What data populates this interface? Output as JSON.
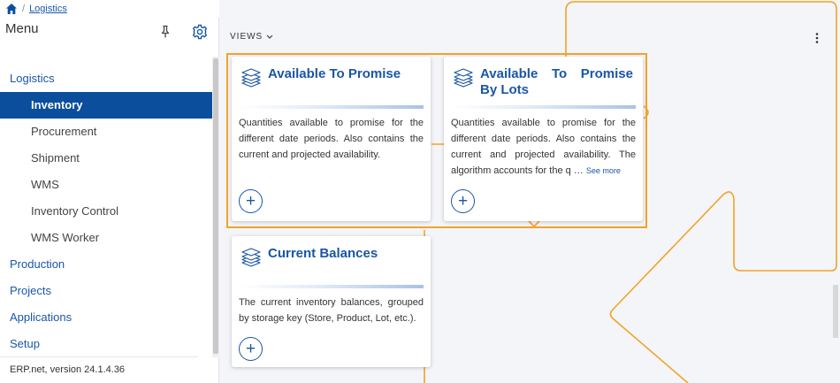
{
  "breadcrumb": {
    "separator": "/",
    "current": "Logistics"
  },
  "menu": {
    "title": "Menu",
    "items": [
      {
        "label": "Logistics",
        "level": 0
      },
      {
        "label": "Inventory",
        "level": 1,
        "active": true
      },
      {
        "label": "Procurement",
        "level": 1
      },
      {
        "label": "Shipment",
        "level": 1
      },
      {
        "label": "WMS",
        "level": 1
      },
      {
        "label": "Inventory Control",
        "level": 1
      },
      {
        "label": "WMS Worker",
        "level": 1
      },
      {
        "label": "Production",
        "level": 0
      },
      {
        "label": "Projects",
        "level": 0
      },
      {
        "label": "Applications",
        "level": 0
      },
      {
        "label": "Setup",
        "level": 0
      }
    ],
    "version": "ERP.net, version 24.1.4.36"
  },
  "main": {
    "views_label": "VIEWS",
    "cards": [
      {
        "title": "Available To Promise",
        "description": "Quantities available to promise for the different date periods. Also contains the current and projected availability.",
        "add": "+"
      },
      {
        "title": "Available To Promise By Lots",
        "description": "Quantities available to promise for the different date periods. Also contains the current and projected availability. The algorithm accounts for the q …",
        "see_more": "See more",
        "add": "+"
      },
      {
        "title": "Current Balances",
        "description": "The current inventory balances, grouped by storage key (Store, Product, Lot, etc.).",
        "add": "+"
      }
    ]
  },
  "colors": {
    "accent": "#1a56a6",
    "active_bg": "#0b4f9c",
    "highlight": "#f0a32a"
  },
  "icons": [
    "home-icon",
    "pin-icon",
    "gear-icon",
    "chevron-down-icon",
    "kebab-menu-icon",
    "stack-icon",
    "plus-icon"
  ]
}
